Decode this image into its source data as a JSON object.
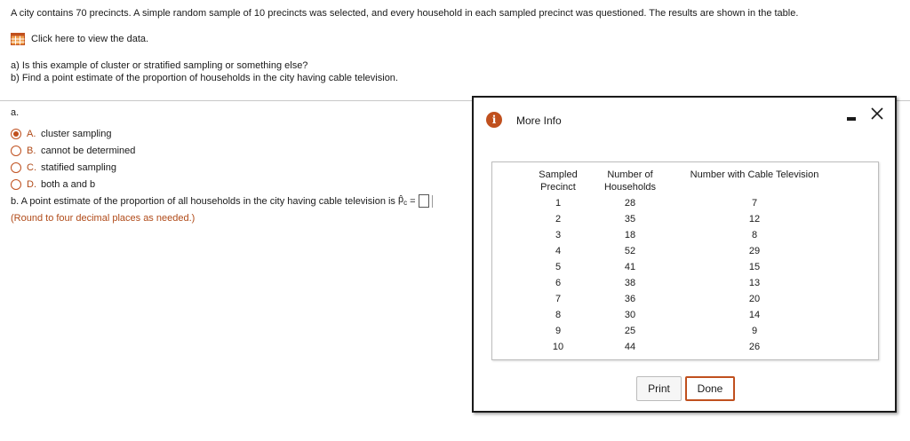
{
  "question_text": "A city contains 70 precincts. A simple random sample of 10 precincts was selected, and every household in each sampled precinct was questioned. The results are shown in the table.",
  "data_link_label": "Click here to view the data.",
  "sub_questions": {
    "a": "a) Is this example of cluster or stratified sampling or something else?",
    "b": "b) Find a point estimate of the proportion of households in the city having cable television."
  },
  "part_a": {
    "label": "a.",
    "options": [
      {
        "letter": "A.",
        "text": "cluster sampling",
        "selected": true
      },
      {
        "letter": "B.",
        "text": "cannot be determined",
        "selected": false
      },
      {
        "letter": "C.",
        "text": "statified sampling",
        "selected": false
      },
      {
        "letter": "D.",
        "text": "both a and b",
        "selected": false
      }
    ]
  },
  "part_b": {
    "text": "b. A point estimate of the proportion of all households in the city having cable television is",
    "symbol": "p̂",
    "subscript": "c",
    "equals": "=",
    "note": "(Round to four decimal places as needed.)",
    "answer": ""
  },
  "modal": {
    "title": "More Info",
    "info_icon": "i",
    "headers": {
      "col1_line1": "Sampled",
      "col1_line2": "Precinct",
      "col2_line1": "Number of",
      "col2_line2": "Households",
      "col3": "Number with Cable Television"
    },
    "rows": [
      [
        "1",
        "28",
        "7"
      ],
      [
        "2",
        "35",
        "12"
      ],
      [
        "3",
        "18",
        "8"
      ],
      [
        "4",
        "52",
        "29"
      ],
      [
        "5",
        "41",
        "15"
      ],
      [
        "6",
        "38",
        "13"
      ],
      [
        "7",
        "36",
        "20"
      ],
      [
        "8",
        "30",
        "14"
      ],
      [
        "9",
        "25",
        "9"
      ],
      [
        "10",
        "44",
        "26"
      ]
    ],
    "print_label": "Print",
    "done_label": "Done"
  },
  "colors": {
    "accent": "#c0501e",
    "text": "#1a1a1a"
  },
  "icons": {
    "data_link": "table-icon",
    "info": "info-icon",
    "minimize": "minimize-icon",
    "close": "close-icon"
  }
}
